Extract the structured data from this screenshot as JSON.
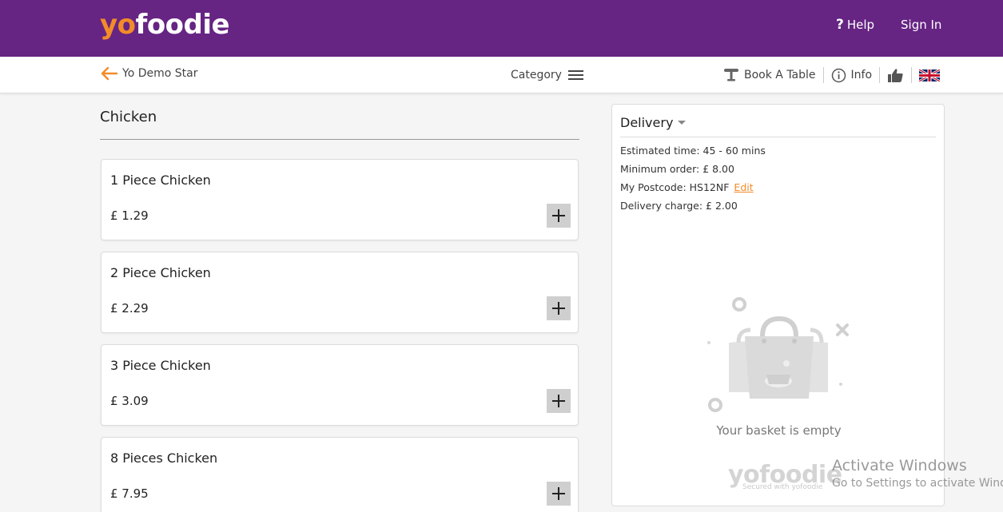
{
  "header": {
    "logo_yo": "yo",
    "logo_foodie": "foodie",
    "help_label": "Help",
    "signin_label": "Sign In",
    "brand_color": "#662483",
    "accent_color": "#f28c28"
  },
  "subnav": {
    "back_label": "Yo Demo Star",
    "category_label": "Category",
    "book_table_label": "Book A Table",
    "info_label": "Info"
  },
  "menu": {
    "section_title": "Chicken",
    "items": [
      {
        "name": "1 Piece Chicken",
        "price": "£ 1.29"
      },
      {
        "name": "2 Piece Chicken",
        "price": "£ 2.29"
      },
      {
        "name": "3 Piece Chicken",
        "price": "£ 3.09"
      },
      {
        "name": "8 Pieces Chicken",
        "price": "£ 7.95"
      }
    ]
  },
  "basket": {
    "mode_label": "Delivery",
    "estimated_time": "Estimated time: 45 - 60 mins",
    "minimum_order": "Minimum order: £ 8.00",
    "postcode": "My Postcode: HS12NF",
    "edit_label": "Edit",
    "delivery_charge": "Delivery charge: £ 2.00",
    "empty_text": "Your basket is empty",
    "footer_logo": "yofoodie",
    "footer_sub": "Secured with yofoodie"
  },
  "watermark": {
    "line1": "Activate Windows",
    "line2": "Go to Settings to activate Windows."
  }
}
